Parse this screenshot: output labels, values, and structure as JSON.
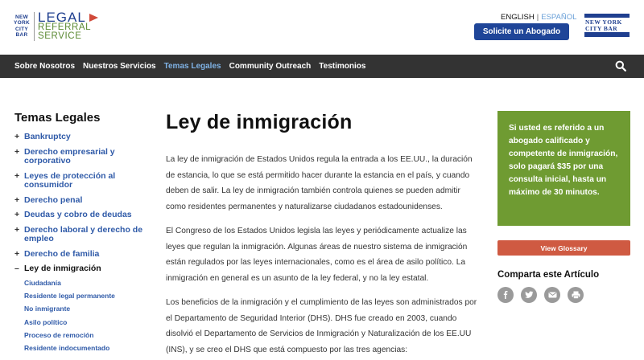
{
  "header": {
    "logo_nyc": [
      "NEW",
      "YORK",
      "CITY",
      "BAR"
    ],
    "logo_lrs": [
      "LEGAL",
      "REFERRAL",
      "SERVICE"
    ],
    "lang_en": "ENGLISH",
    "lang_sep": "|",
    "lang_es": "ESPAÑOL",
    "cta_label": "Solicite un Abogado",
    "ncb_logo": [
      "NEW YORK",
      "CITY BAR"
    ]
  },
  "nav": {
    "items": [
      "Sobre Nosotros",
      "Nuestros Servicios",
      "Temas Legales",
      "Community Outreach",
      "Testimonios"
    ],
    "active_index": 2
  },
  "sidebar": {
    "title": "Temas Legales",
    "items": [
      {
        "marker": "+",
        "label": "Bankruptcy"
      },
      {
        "marker": "+",
        "label": "Derecho empresarial y corporativo"
      },
      {
        "marker": "+",
        "label": "Leyes de protección al consumidor"
      },
      {
        "marker": "+",
        "label": "Derecho penal"
      },
      {
        "marker": "+",
        "label": "Deudas y cobro de deudas"
      },
      {
        "marker": "+",
        "label": "Derecho laboral y derecho de empleo"
      },
      {
        "marker": "+",
        "label": "Derecho de familia"
      },
      {
        "marker": "–",
        "label": "Ley de inmigración"
      }
    ],
    "subitems": [
      "Ciudadanía",
      "Residente legal permanente",
      "No inmigrante",
      "Asilo político",
      "Proceso de remoción",
      "Residente indocumentado"
    ]
  },
  "main": {
    "title": "Ley de inmigración",
    "paragraphs": [
      "La ley de inmigración de Estados Unidos regula la entrada a los EE.UU., la duración de estancia, lo que se está permitido hacer durante la estancia en el país, y cuando deben de salir.  La ley de inmigración también controla quienes se pueden admitir como residentes permanentes y naturalizarse ciudadanos estadounidenses.",
      "El Congreso de los Estados Unidos legisla las leyes y periódicamente actualize las leyes que regulan la inmigración.  Algunas áreas de nuestro sistema de inmigración están regulados por las leyes internacionales, como es el área de asilo político. La inmigración en general es un asunto de la ley federal, y no la ley estatal.",
      "Los beneficios de la inmigración y el cumplimiento de las leyes son administrados por el Departamento de Seguridad Interior (DHS).  DHS fue creado en 2003, cuando disolvió el Departamento de Servicios de Inmigración y Naturalización de los EE.UU (INS), y se creo el DHS que está compuesto por las tres agencias:"
    ]
  },
  "aside": {
    "promo": "Si usted es referido a un abogado calificado y competente de inmigración, solo pagará $35 por una consulta inicial, hasta un máximo de 30 minutos.",
    "glossary_label": "View Glossary",
    "share_title": "Comparta este Artículo",
    "share_icons": [
      "facebook-icon",
      "twitter-icon",
      "email-icon",
      "print-icon"
    ]
  },
  "colors": {
    "nav_bg": "#333333",
    "brand_blue": "#1f4598",
    "active_nav": "#7fb2e5",
    "promo_green": "#6f9b32",
    "glossary_red": "#cf5a42",
    "link_blue": "#2f5aa8"
  }
}
